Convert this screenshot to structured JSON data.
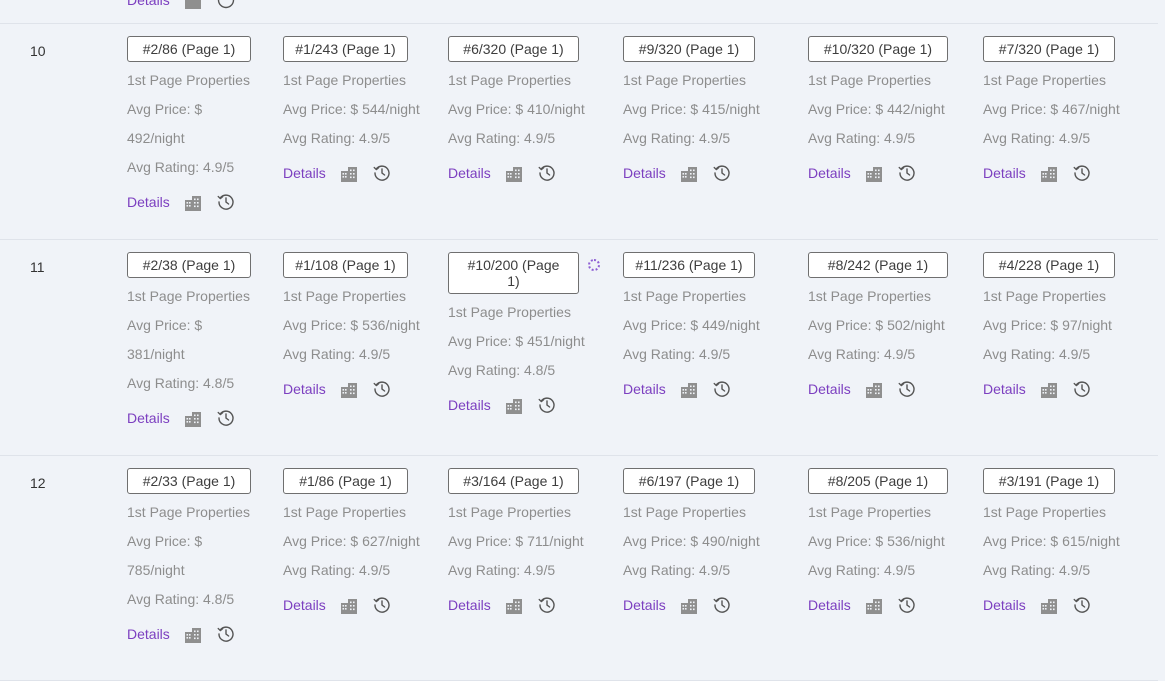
{
  "labels": {
    "first_page": "1st Page Properties",
    "details": "Details"
  },
  "colors": {
    "accent": "#7c3fc0",
    "text_muted": "#8d8d8d",
    "background": "#f0f3f8"
  },
  "icons": {
    "building": "building-icon",
    "history": "history-clock-icon"
  },
  "top_partial_row": {
    "details": "Details"
  },
  "rows": [
    {
      "rank": "10",
      "cells": [
        {
          "badge": [
            "#2/86 (Page 1)"
          ],
          "price": [
            "Avg Price: $",
            "492/night"
          ],
          "rating": "Avg Rating: 4.9/5"
        },
        {
          "badge": [
            "#1/243 (Page 1)"
          ],
          "price": [
            "Avg Price: $ 544/night"
          ],
          "rating": "Avg Rating: 4.9/5"
        },
        {
          "badge": [
            "#6/320 (Page 1)"
          ],
          "price": [
            "Avg Price: $ 410/night"
          ],
          "rating": "Avg Rating: 4.9/5"
        },
        {
          "badge": [
            "#9/320 (Page 1)"
          ],
          "price": [
            "Avg Price: $ 415/night"
          ],
          "rating": "Avg Rating: 4.9/5"
        },
        {
          "badge": [
            "#10/320 (Page 1)"
          ],
          "price": [
            "Avg Price: $ 442/night"
          ],
          "rating": "Avg Rating: 4.9/5"
        },
        {
          "badge": [
            "#7/320 (Page 1)"
          ],
          "price": [
            "Avg Price: $ 467/night"
          ],
          "rating": "Avg Rating: 4.9/5"
        }
      ]
    },
    {
      "rank": "11",
      "cells": [
        {
          "badge": [
            "#2/38 (Page 1)"
          ],
          "price": [
            "Avg Price: $",
            "381/night"
          ],
          "rating": "Avg Rating: 4.8/5"
        },
        {
          "badge": [
            "#1/108 (Page 1)"
          ],
          "price": [
            "Avg Price: $ 536/night"
          ],
          "rating": "Avg Rating: 4.9/5"
        },
        {
          "badge": [
            "#10/200 (Page",
            "1)"
          ],
          "loading": true,
          "price": [
            "Avg Price: $ 451/night"
          ],
          "rating": "Avg Rating: 4.8/5"
        },
        {
          "badge": [
            "#11/236 (Page 1)"
          ],
          "price": [
            "Avg Price: $ 449/night"
          ],
          "rating": "Avg Rating: 4.9/5"
        },
        {
          "badge": [
            "#8/242 (Page 1)"
          ],
          "price": [
            "Avg Price: $ 502/night"
          ],
          "rating": "Avg Rating: 4.9/5"
        },
        {
          "badge": [
            "#4/228 (Page 1)"
          ],
          "price": [
            "Avg Price: $ 97/night"
          ],
          "rating": "Avg Rating: 4.9/5"
        }
      ]
    },
    {
      "rank": "12",
      "cells": [
        {
          "badge": [
            "#2/33 (Page 1)"
          ],
          "price": [
            "Avg Price: $",
            "785/night"
          ],
          "rating": "Avg Rating: 4.8/5"
        },
        {
          "badge": [
            "#1/86 (Page 1)"
          ],
          "price": [
            "Avg Price: $ 627/night"
          ],
          "rating": "Avg Rating: 4.9/5"
        },
        {
          "badge": [
            "#3/164 (Page 1)"
          ],
          "price": [
            "Avg Price: $ 711/night"
          ],
          "rating": "Avg Rating: 4.9/5"
        },
        {
          "badge": [
            "#6/197 (Page 1)"
          ],
          "price": [
            "Avg Price: $ 490/night"
          ],
          "rating": "Avg Rating: 4.9/5"
        },
        {
          "badge": [
            "#8/205 (Page 1)"
          ],
          "price": [
            "Avg Price: $ 536/night"
          ],
          "rating": "Avg Rating: 4.9/5"
        },
        {
          "badge": [
            "#3/191 (Page 1)"
          ],
          "price": [
            "Avg Price: $ 615/night"
          ],
          "rating": "Avg Rating: 4.9/5"
        }
      ]
    }
  ]
}
